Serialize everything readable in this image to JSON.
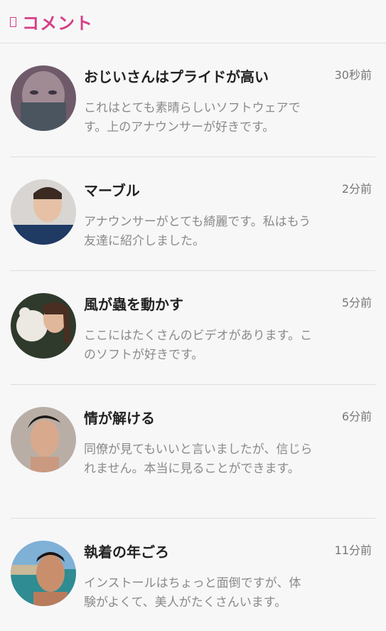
{
  "header": {
    "title": "コメント",
    "icon": "comment-icon",
    "accent": "#d63f86"
  },
  "comments": [
    {
      "name": "おじいさんはプライドが高い",
      "time": "30秒前",
      "text": "これはとても素晴らしいソフトウェアです。上のアナウンサーが好きです。"
    },
    {
      "name": "マーブル",
      "time": "2分前",
      "text": "アナウンサーがとても綺麗です。私はもう友達に紹介しました。"
    },
    {
      "name": "風が蟲を動かす",
      "time": "5分前",
      "text": "ここにはたくさんのビデオがあります。このソフトが好きです。"
    },
    {
      "name": "情が解ける",
      "time": "6分前",
      "text": "同僚が見てもいいと言いましたが、信じられません。本当に見ることができます。"
    },
    {
      "name": "執着の年ごろ",
      "time": "11分前",
      "text": "インストールはちょっと面倒ですが、体験がよくて、美人がたくさんいます。"
    }
  ]
}
